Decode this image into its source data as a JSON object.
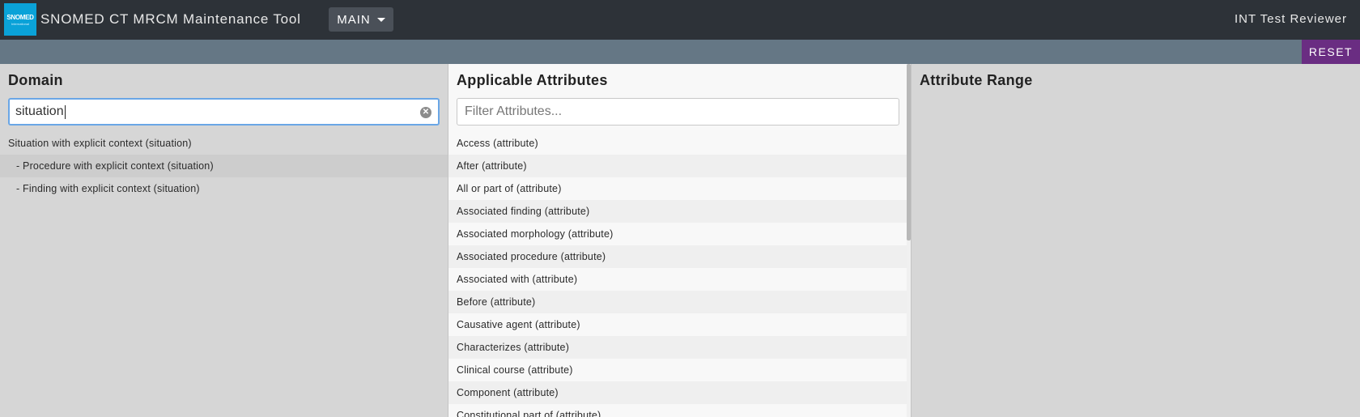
{
  "header": {
    "logo_text": "SNOMED",
    "logo_subtext": "International",
    "app_title": "SNOMED CT MRCM Maintenance Tool",
    "branch_label": "MAIN",
    "user_name": "INT Test Reviewer"
  },
  "toolbar": {
    "reset_label": "RESET"
  },
  "domain_panel": {
    "title": "Domain",
    "search_value": "situation",
    "items": [
      "Situation with explicit context (situation)",
      "- Procedure with explicit context (situation)",
      "- Finding with explicit context (situation)"
    ]
  },
  "attributes_panel": {
    "title": "Applicable Attributes",
    "filter_placeholder": "Filter Attributes...",
    "items": [
      "Access (attribute)",
      "After (attribute)",
      "All or part of (attribute)",
      "Associated finding (attribute)",
      "Associated morphology (attribute)",
      "Associated procedure (attribute)",
      "Associated with (attribute)",
      "Before (attribute)",
      "Causative agent (attribute)",
      "Characterizes (attribute)",
      "Clinical course (attribute)",
      "Component (attribute)",
      "Constitutional part of (attribute)"
    ]
  },
  "range_panel": {
    "title": "Attribute Range"
  }
}
